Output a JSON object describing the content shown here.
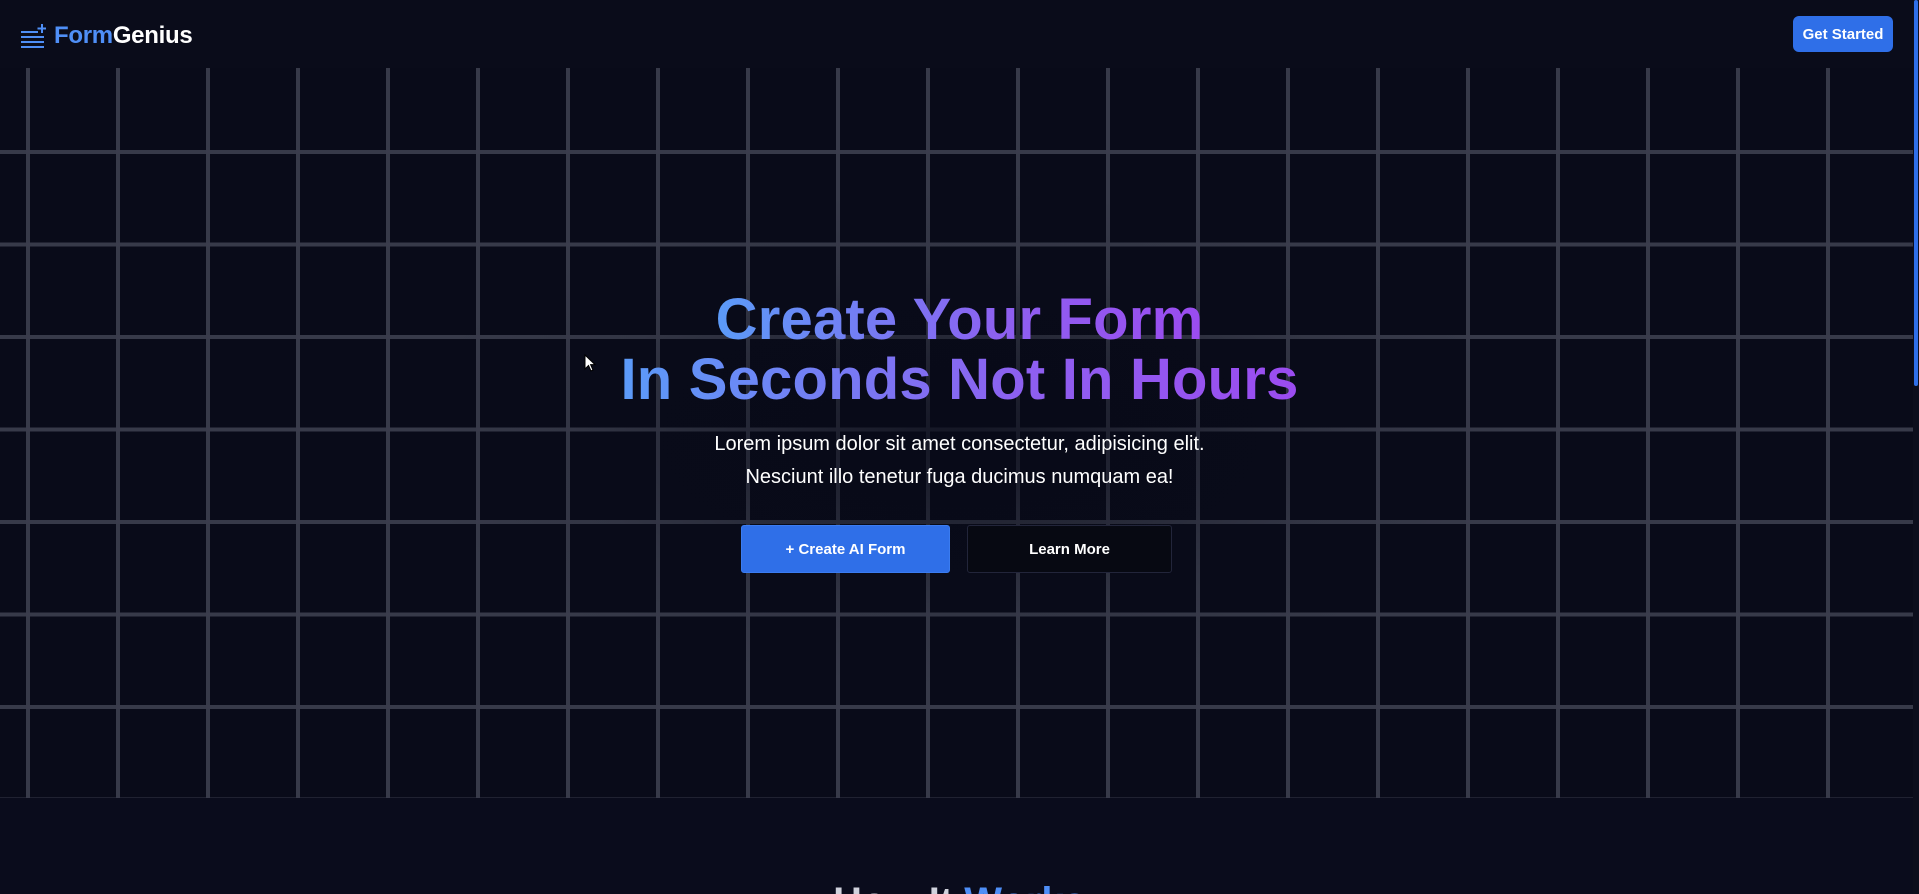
{
  "header": {
    "logo_part1": "Form",
    "logo_part2": "Genius",
    "logo_icon": "stacked-lines-sparkle-icon",
    "cta_label": "Get Started"
  },
  "hero": {
    "title_line1": "Create Your Form",
    "title_line2": "In Seconds Not In Hours",
    "subtitle_line1": "Lorem ipsum dolor sit amet consectetur, adipisicing elit.",
    "subtitle_line2": "Nesciunt illo tenetur fuga ducimus numquam ea!",
    "primary_button": "+ Create AI Form",
    "secondary_button": "Learn More"
  },
  "next_section": {
    "title_part1": "How It",
    "title_part2": "Works"
  },
  "colors": {
    "background": "#080a18",
    "accent": "#2f6fe8",
    "gradient_start": "#5b9bf8",
    "gradient_end": "#9b4cf0"
  }
}
